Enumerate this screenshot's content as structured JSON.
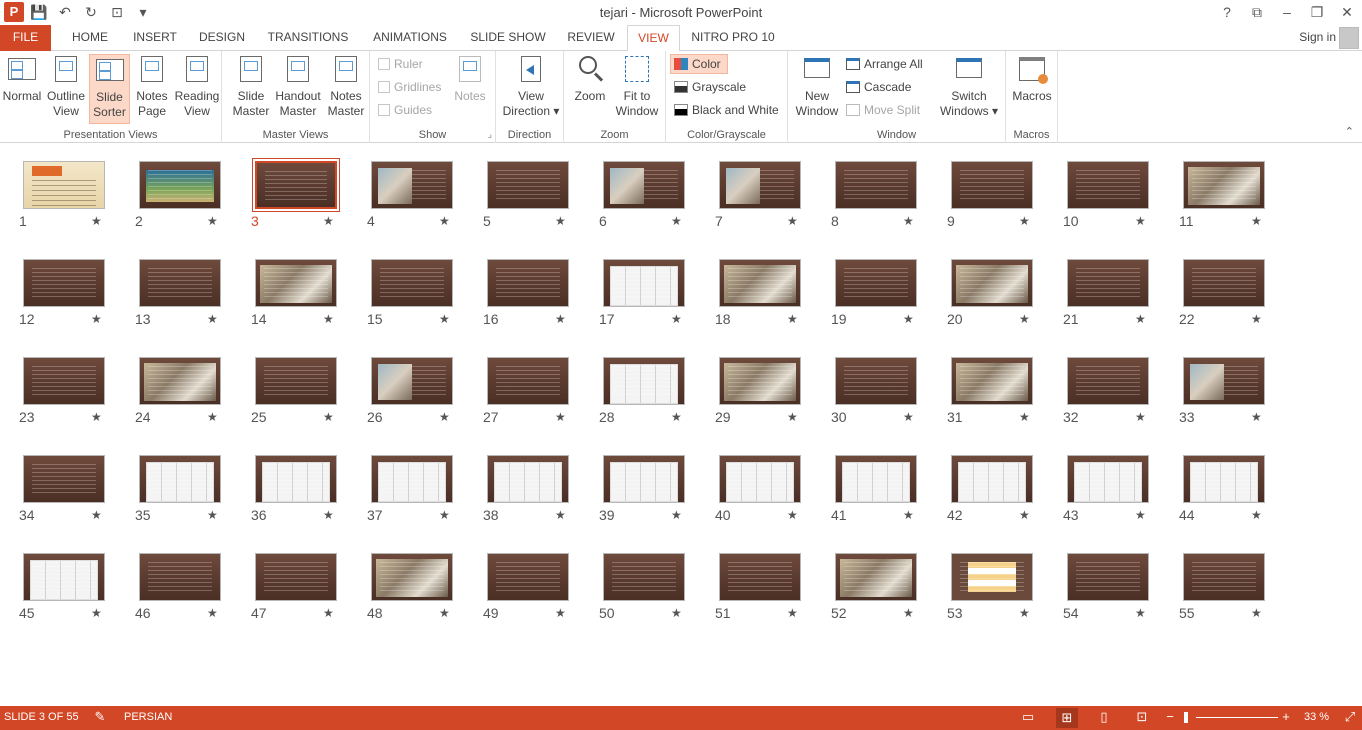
{
  "app": {
    "title": "tejari - Microsoft PowerPoint",
    "logo": "P",
    "qat": {
      "save": "💾",
      "undo": "↶",
      "redo": "↻",
      "presentation": "⊡",
      "more": "▾"
    },
    "window_controls": {
      "help": "?",
      "restore_ribbon": "⧉",
      "minimize": "–",
      "maximize": "❐",
      "close": "✕"
    },
    "signin": "Sign in"
  },
  "tabs": [
    "FILE",
    "HOME",
    "INSERT",
    "DESIGN",
    "TRANSITIONS",
    "ANIMATIONS",
    "SLIDE SHOW",
    "REVIEW",
    "VIEW",
    "NITRO PRO 10"
  ],
  "ribbon": {
    "presentation_views": {
      "label": "Presentation Views",
      "normal": "Normal",
      "outline": "Outline\nView",
      "slide_sorter": "Slide\nSorter",
      "notes_page": "Notes\nPage",
      "reading_view": "Reading\nView"
    },
    "master_views": {
      "label": "Master Views",
      "slide_master": "Slide\nMaster",
      "handout_master": "Handout\nMaster",
      "notes_master": "Notes\nMaster"
    },
    "show": {
      "label": "Show",
      "ruler": "Ruler",
      "gridlines": "Gridlines",
      "guides": "Guides",
      "notes": "Notes"
    },
    "direction": {
      "label": "Direction",
      "view_direction": "View\nDirection ▾"
    },
    "zoom": {
      "label": "Zoom",
      "zoom": "Zoom",
      "fit": "Fit to\nWindow"
    },
    "color": {
      "label": "Color/Grayscale",
      "color": "Color",
      "grayscale": "Grayscale",
      "bw": "Black and White"
    },
    "window": {
      "label": "Window",
      "new_window": "New\nWindow",
      "arrange_all": "Arrange All",
      "cascade": "Cascade",
      "move_split": "Move Split",
      "switch": "Switch\nWindows ▾"
    },
    "macros": {
      "label": "Macros",
      "macros": "Macros"
    },
    "collapse": "⌃"
  },
  "slides": {
    "selected": 3,
    "count": 55,
    "star": "★"
  },
  "status": {
    "slide_info": "SLIDE 3 OF 55",
    "language": "PERSIAN",
    "zoom": "33 %",
    "zoom_minus": "−",
    "zoom_plus": "+"
  }
}
